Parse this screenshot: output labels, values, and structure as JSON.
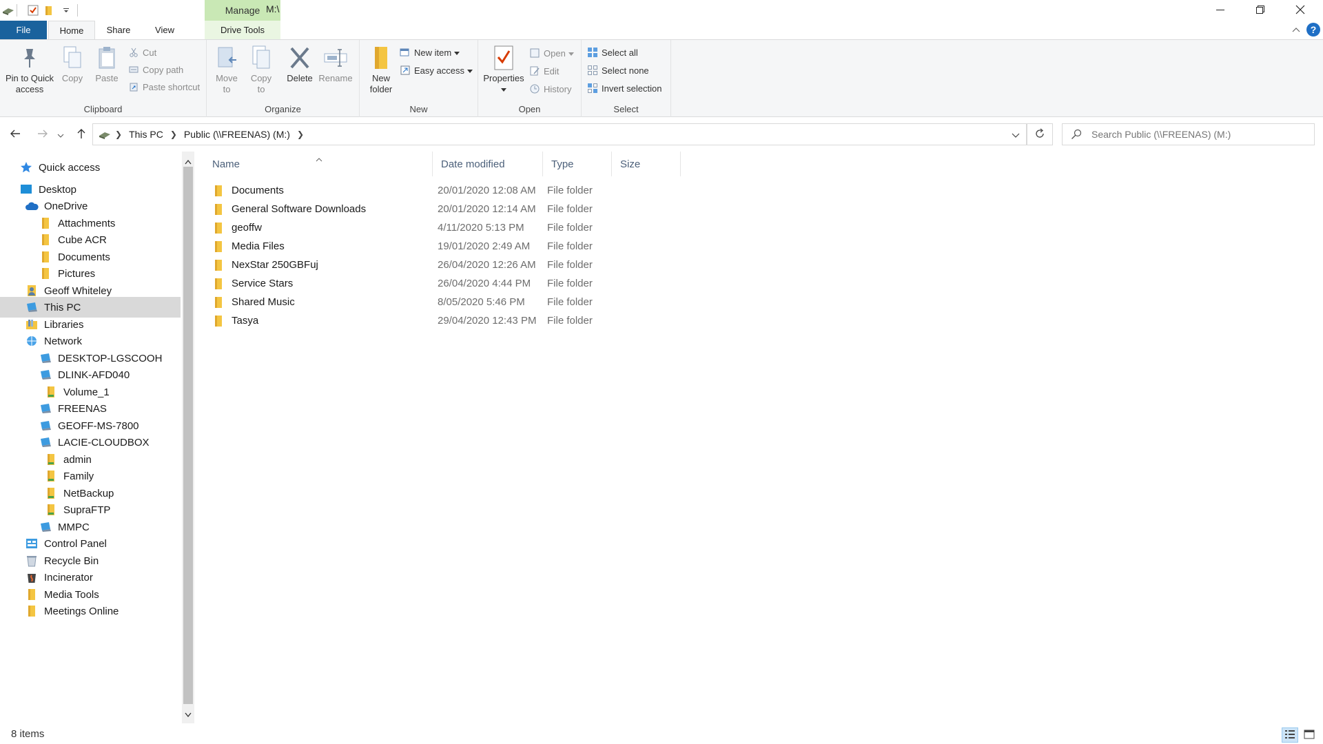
{
  "window": {
    "title": "M:\\",
    "context_tab": "Manage"
  },
  "tabs": {
    "file": "File",
    "home": "Home",
    "share": "Share",
    "view": "View",
    "drive_tools": "Drive Tools"
  },
  "ribbon": {
    "clipboard": {
      "label": "Clipboard",
      "pin_line1": "Pin to Quick",
      "pin_line2": "access",
      "copy": "Copy",
      "paste": "Paste",
      "cut": "Cut",
      "copy_path": "Copy path",
      "paste_shortcut": "Paste shortcut"
    },
    "organize": {
      "label": "Organize",
      "move_line1": "Move",
      "move_line2": "to",
      "copy_line1": "Copy",
      "copy_line2": "to",
      "delete": "Delete",
      "rename": "Rename"
    },
    "new": {
      "label": "New",
      "folder_line1": "New",
      "folder_line2": "folder",
      "new_item": "New item",
      "easy_access": "Easy access"
    },
    "open": {
      "label": "Open",
      "properties": "Properties",
      "open": "Open",
      "edit": "Edit",
      "history": "History"
    },
    "select": {
      "label": "Select",
      "select_all": "Select all",
      "select_none": "Select none",
      "invert": "Invert selection"
    }
  },
  "address": {
    "crumbs": [
      "This PC",
      "Public (\\\\FREENAS) (M:)"
    ],
    "search_placeholder": "Search Public (\\\\FREENAS) (M:)"
  },
  "nav": {
    "items": [
      {
        "label": "Quick access",
        "icon": "star-icon"
      },
      {
        "label": "Desktop",
        "icon": "desktop-icon"
      },
      {
        "label": "OneDrive",
        "icon": "cloud-icon"
      },
      {
        "label": "Attachments",
        "icon": "folder-icon"
      },
      {
        "label": "Cube ACR",
        "icon": "folder-icon"
      },
      {
        "label": "Documents",
        "icon": "folder-icon"
      },
      {
        "label": "Pictures",
        "icon": "folder-icon"
      },
      {
        "label": "Geoff Whiteley",
        "icon": "user-folder-icon"
      },
      {
        "label": "This PC",
        "icon": "computer-icon"
      },
      {
        "label": "Libraries",
        "icon": "libraries-icon"
      },
      {
        "label": "Network",
        "icon": "network-icon"
      },
      {
        "label": "DESKTOP-LGSCOOH",
        "icon": "computer-icon"
      },
      {
        "label": "DLINK-AFD040",
        "icon": "computer-icon"
      },
      {
        "label": "Volume_1",
        "icon": "share-folder-icon"
      },
      {
        "label": "FREENAS",
        "icon": "computer-icon"
      },
      {
        "label": "GEOFF-MS-7800",
        "icon": "computer-icon"
      },
      {
        "label": "LACIE-CLOUDBOX",
        "icon": "computer-icon"
      },
      {
        "label": "admin",
        "icon": "share-folder-icon"
      },
      {
        "label": "Family",
        "icon": "share-folder-icon"
      },
      {
        "label": "NetBackup",
        "icon": "share-folder-icon"
      },
      {
        "label": "SupraFTP",
        "icon": "share-folder-icon"
      },
      {
        "label": "MMPC",
        "icon": "computer-icon"
      },
      {
        "label": "Control Panel",
        "icon": "control-panel-icon"
      },
      {
        "label": "Recycle Bin",
        "icon": "recycle-bin-icon"
      },
      {
        "label": "Incinerator",
        "icon": "incinerator-icon"
      },
      {
        "label": "Media Tools",
        "icon": "folder-icon"
      },
      {
        "label": "Meetings Online",
        "icon": "folder-icon"
      }
    ]
  },
  "columns": {
    "name": "Name",
    "date": "Date modified",
    "type": "Type",
    "size": "Size"
  },
  "files": [
    {
      "name": "Documents",
      "date": "20/01/2020 12:08 AM",
      "type": "File folder"
    },
    {
      "name": "General Software Downloads",
      "date": "20/01/2020 12:14 AM",
      "type": "File folder"
    },
    {
      "name": "geoffw",
      "date": "4/11/2020 5:13 PM",
      "type": "File folder"
    },
    {
      "name": "Media Files",
      "date": "19/01/2020 2:49 AM",
      "type": "File folder"
    },
    {
      "name": "NexStar 250GBFuj",
      "date": "26/04/2020 12:26 AM",
      "type": "File folder"
    },
    {
      "name": "Service Stars",
      "date": "26/04/2020 4:44 PM",
      "type": "File folder"
    },
    {
      "name": "Shared Music",
      "date": "8/05/2020 5:46 PM",
      "type": "File folder"
    },
    {
      "name": "Tasya",
      "date": "29/04/2020 12:43 PM",
      "type": "File folder"
    }
  ],
  "status": {
    "count": "8 items"
  },
  "colors": {
    "file_tab": "#19629d",
    "manage_tab": "#c9e8b5",
    "folder": "#f4c542"
  }
}
